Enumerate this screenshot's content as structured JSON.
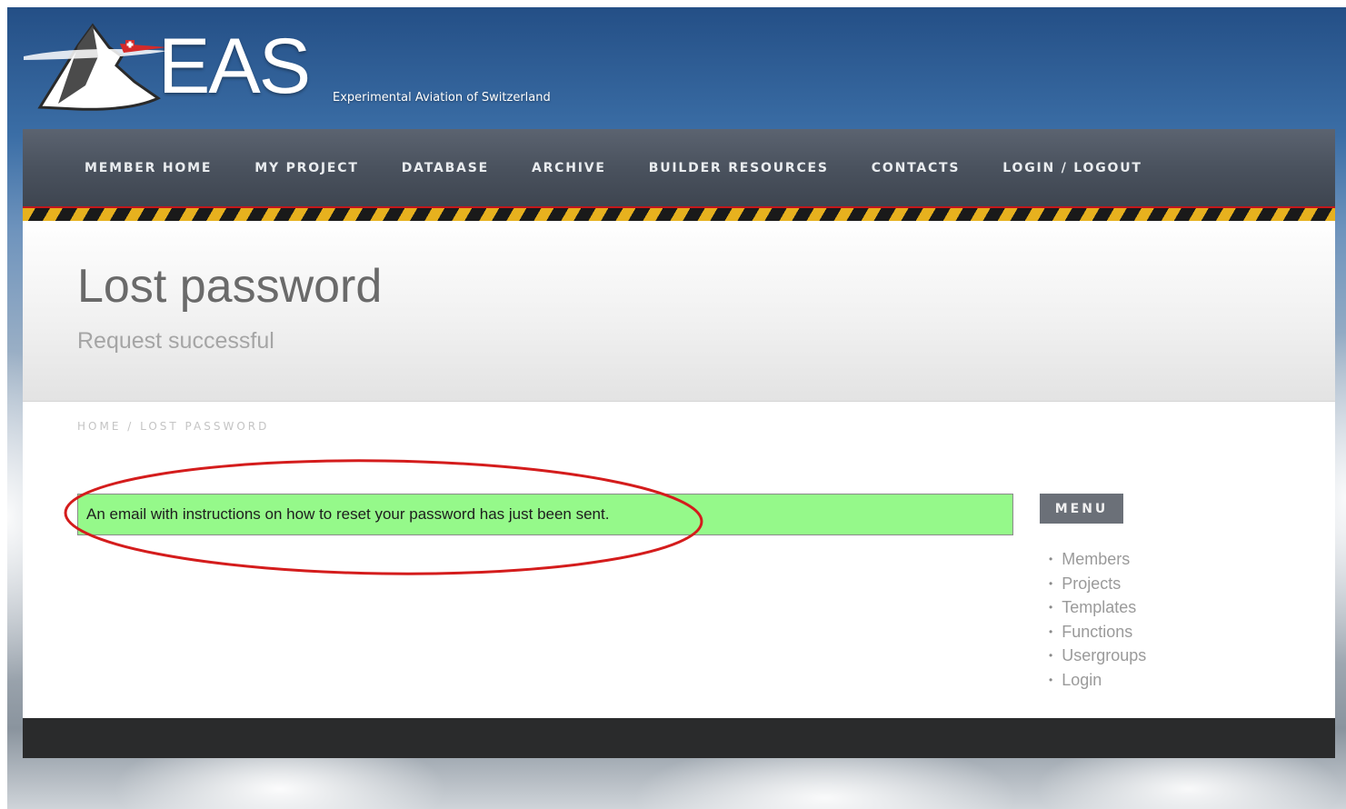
{
  "logo": {
    "text": "EAS",
    "tagline": "Experimental Aviation of Switzerland"
  },
  "nav": {
    "items": [
      {
        "label": "MEMBER HOME"
      },
      {
        "label": "MY PROJECT"
      },
      {
        "label": "DATABASE"
      },
      {
        "label": "ARCHIVE"
      },
      {
        "label": "BUILDER RESOURCES"
      },
      {
        "label": "CONTACTS"
      },
      {
        "label": "LOGIN / LOGOUT"
      }
    ]
  },
  "page": {
    "title": "Lost password",
    "subtitle": "Request successful"
  },
  "breadcrumb": {
    "home": "HOME",
    "separator": " / ",
    "current": "LOST PASSWORD"
  },
  "notice": {
    "message": "An email with instructions on how to reset your password has just been sent."
  },
  "sidebar": {
    "heading": "MENU",
    "items": [
      {
        "label": "Members"
      },
      {
        "label": "Projects"
      },
      {
        "label": "Templates"
      },
      {
        "label": "Functions"
      },
      {
        "label": "Usergroups"
      },
      {
        "label": "Login"
      }
    ]
  },
  "colors": {
    "notice_background": "#95f98a",
    "highlight_ring": "#d41c1c",
    "hazard_yellow": "#e7b11e"
  }
}
